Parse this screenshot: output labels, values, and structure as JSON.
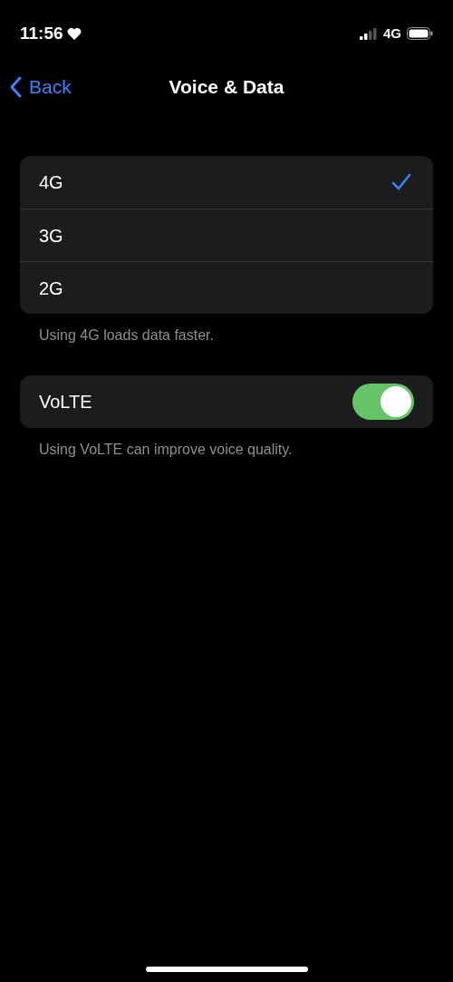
{
  "status_bar": {
    "time": "11:56",
    "network": "4G"
  },
  "nav": {
    "back": "Back",
    "title": "Voice & Data"
  },
  "options": [
    {
      "label": "4G",
      "selected": true
    },
    {
      "label": "3G",
      "selected": false
    },
    {
      "label": "2G",
      "selected": false
    }
  ],
  "options_footer": "Using 4G loads data faster.",
  "volte": {
    "label": "VoLTE",
    "on": true
  },
  "volte_footer": "Using VoLTE can improve voice quality."
}
